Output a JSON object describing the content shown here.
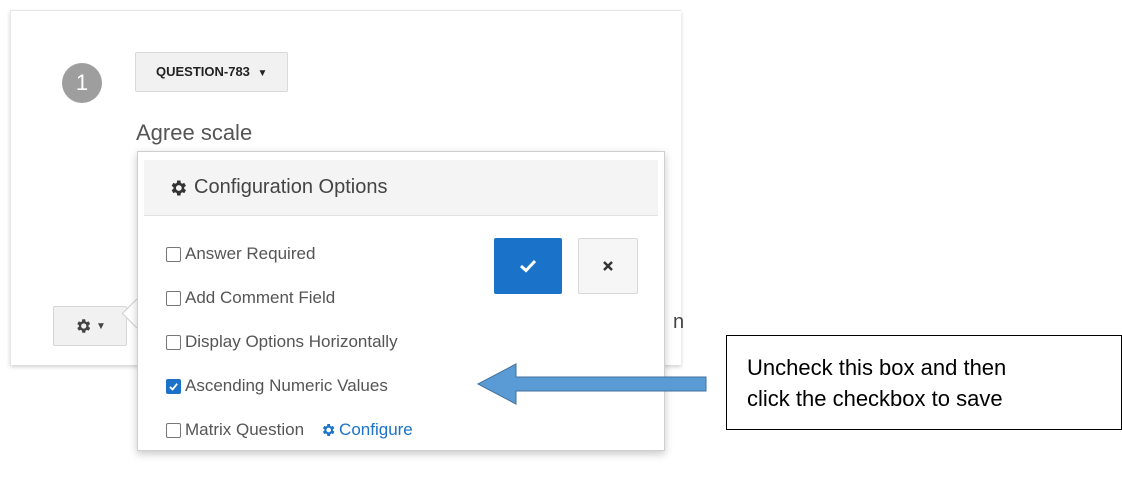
{
  "question": {
    "number": "1",
    "tag_label": "QUESTION-783",
    "text": "Agree scale",
    "stray_text": "n"
  },
  "popover": {
    "title": "Configuration Options",
    "options": [
      {
        "label": "Answer Required",
        "checked": false
      },
      {
        "label": "Add Comment Field",
        "checked": false
      },
      {
        "label": "Display Options Horizontally",
        "checked": false
      },
      {
        "label": "Ascending Numeric Values",
        "checked": true
      },
      {
        "label": "Matrix Question",
        "checked": false
      }
    ],
    "configure_label": "Configure"
  },
  "annotation": {
    "line1": "Uncheck this box and then",
    "line2": "click the checkbox to save"
  },
  "icons": {
    "gear": "gear-icon",
    "check": "check-icon",
    "close": "close-icon",
    "caret": "caret-down-icon",
    "arrow": "arrow-left-icon"
  },
  "colors": {
    "accent": "#1a73c8",
    "arrow": "#5b9bd5",
    "badge": "#9e9e9e"
  }
}
